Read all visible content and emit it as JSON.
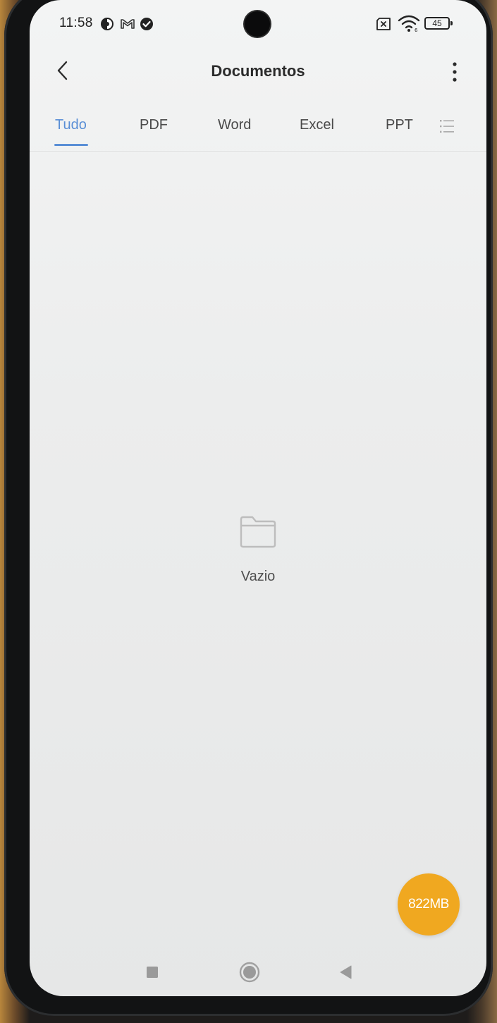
{
  "status_bar": {
    "time": "11:58",
    "battery": "45",
    "icons": [
      "data-saver-icon",
      "gmail-icon",
      "check-circle-icon",
      "sim-off-icon",
      "wifi-icon",
      "battery-icon"
    ]
  },
  "header": {
    "title": "Documentos",
    "back_icon": "chevron-left-icon",
    "menu_icon": "more-vertical-icon"
  },
  "tabs": [
    {
      "label": "Tudo",
      "active": true
    },
    {
      "label": "PDF",
      "active": false
    },
    {
      "label": "Word",
      "active": false
    },
    {
      "label": "Excel",
      "active": false
    },
    {
      "label": "PPT",
      "active": false
    }
  ],
  "empty_state": {
    "icon": "folder-icon",
    "label": "Vazio"
  },
  "storage_button": {
    "label": "822MB"
  },
  "nav_bar": {
    "items": [
      "recents-icon",
      "home-icon",
      "back-icon"
    ]
  },
  "colors": {
    "accent": "#5a8fd6",
    "fab": "#f0a820",
    "background": "#eceded"
  }
}
